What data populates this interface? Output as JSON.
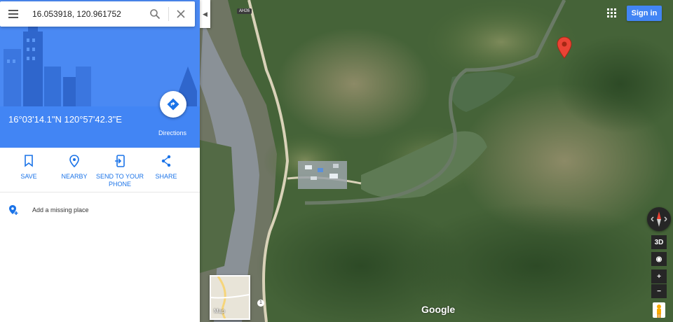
{
  "search": {
    "query": "16.053918, 120.961752"
  },
  "place": {
    "coordinates": "16°03'14.1\"N 120°57'42.3\"E"
  },
  "directions": {
    "label": "Directions"
  },
  "actions": [
    {
      "label": "SAVE",
      "icon": "bookmark-icon"
    },
    {
      "label": "NEARBY",
      "icon": "nearby-pin-icon"
    },
    {
      "label": "SEND TO YOUR PHONE",
      "icon": "send-to-phone-icon"
    },
    {
      "label": "SHARE",
      "icon": "share-icon"
    }
  ],
  "add_place": {
    "label": "Add a missing place"
  },
  "header": {
    "sign_in": "Sign in"
  },
  "map": {
    "road_label": "AH26",
    "route_shield": "1",
    "minimap_label": "Map",
    "attribution": "Google",
    "controls": {
      "tilt": "3D",
      "zoom_in": "+",
      "zoom_out": "−"
    }
  },
  "colors": {
    "accent": "#4285f4",
    "pin": "#ea4335",
    "action_text": "#1a73e8"
  }
}
